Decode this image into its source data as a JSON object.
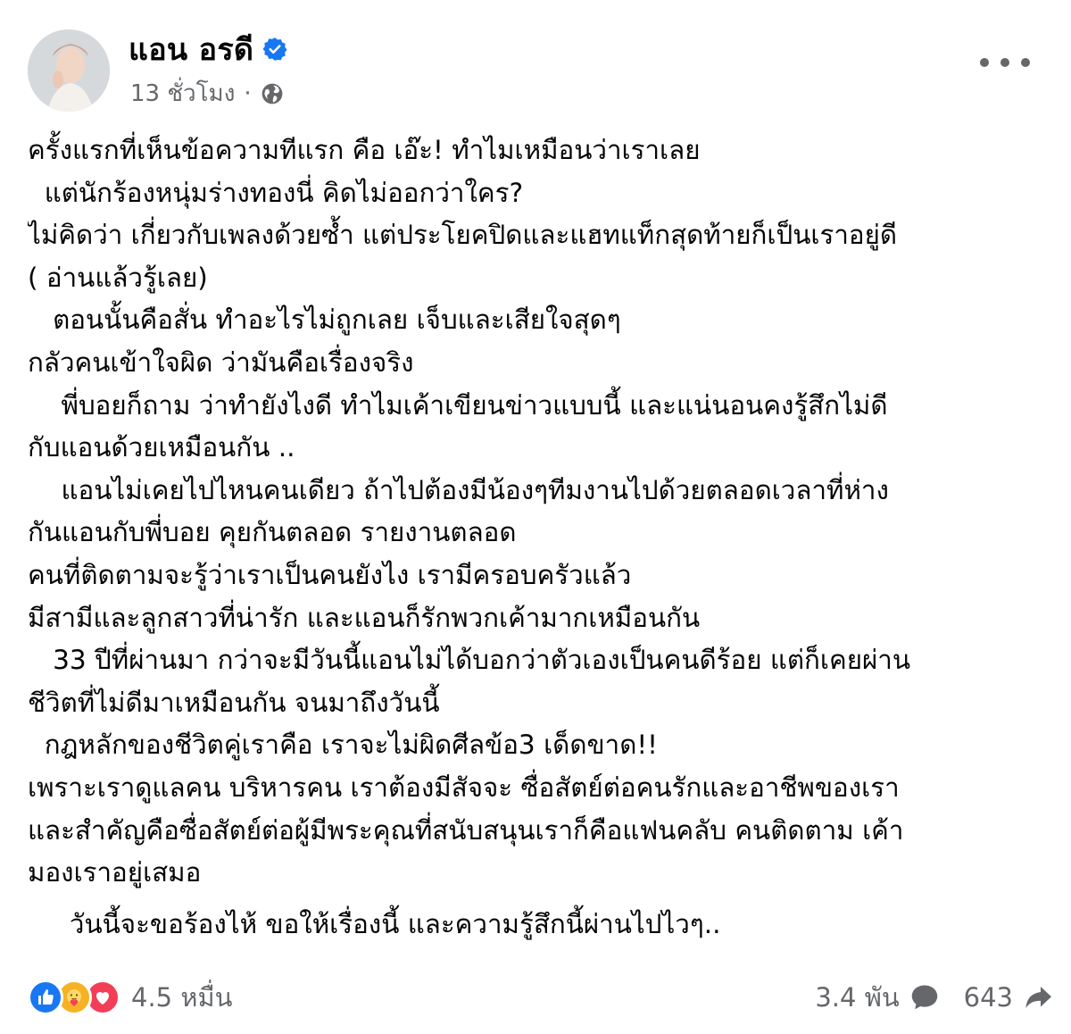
{
  "post": {
    "author_name": "แอน อรดี",
    "verified": true,
    "timestamp": "13 ชั่วโมง",
    "separator": "·",
    "privacy_icon": "globe-icon",
    "menu_icon": "more-options-icon",
    "lines": [
      "ครั้งแรกที่เห็นข้อความทีแรก คือ เอ๊ะ! ทำไมเหมือนว่าเราเลย",
      "  แต่นักร้องหนุ่มร่างทองนี่ คิดไม่ออกว่าใคร?",
      "ไม่คิดว่า เกี่ยวกับเพลงด้วยซ้ำ แต่ประโยคปิดและแฮทแท็กสุดท้ายก็เป็นเราอยู่ดี",
      "( อ่านแล้วรู้เลย)",
      "   ตอนนั้นคือสั่น ทำอะไรไม่ถูกเลย เจ็บและเสียใจสุดๆ",
      "กลัวคนเข้าใจผิด ว่ามันคือเรื่องจริง",
      "    พี่บอยก็ถาม ว่าทำยังไงดี ทำไมเค้าเขียนข่าวแบบนี้ และแน่นอนคงรู้สึกไม่ดี",
      "กับแอนด้วยเหมือนกัน ..",
      "    แอนไม่เคยไปไหนคนเดียว ถ้าไปต้องมีน้องๆทีมงานไปด้วยตลอดเวลาที่ห่าง",
      "กันแอนกับพี่บอย คุยกันตลอด รายงานตลอด",
      "คนที่ติดตามจะรู้ว่าเราเป็นคนยังไง เรามีครอบครัวแล้ว",
      "มีสามีและลูกสาวที่น่ารัก และแอนก็รักพวกเค้ามากเหมือนกัน",
      "   33 ปีที่ผ่านมา กว่าจะมีวันนี้แอนไม่ได้บอกว่าตัวเองเป็นคนดีร้อย แต่ก็เคยผ่าน",
      "ชีวิตที่ไม่ดีมาเหมือนกัน จนมาถึงวันนี้",
      "  กฎหลักของชีวิตคู่เราคือ เราจะไม่ผิดศีลข้อ3 เด็ดขาด!!",
      "เพราะเราดูแลคน บริหารคน เราต้องมีสัจจะ ซื่อสัตย์ต่อคนรักและอาชีพของเรา",
      "และสำคัญคือซื่อสัตย์ต่อผู้มีพระคุณที่สนับสนุนเราก็คือแฟนคลับ คนติดตาม เค้า",
      "มองเราอยู่เสมอ"
    ],
    "closing_line": "     วันนี้จะขอร้องไห้ ขอให้เรื่องนี้ และความรู้สึกนี้ผ่านไปไวๆ.."
  },
  "footer": {
    "reactions": [
      "like-icon",
      "care-icon",
      "love-icon"
    ],
    "reaction_count": "4.5 หมื่น",
    "comment_count": "3.4 พัน",
    "share_count": "643"
  },
  "colors": {
    "text": "#050505",
    "secondary": "#65676b",
    "like_blue": "#1877f2",
    "love_red": "#f33e58",
    "care_yellow": "#f7b125"
  }
}
